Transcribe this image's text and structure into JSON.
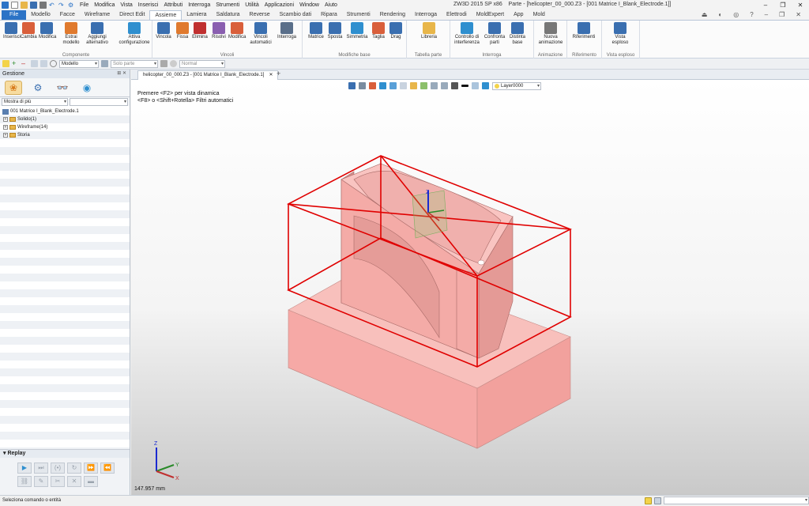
{
  "window": {
    "title": "ZW3D 2015 SP x86",
    "doc_title": "Parte - [helicopter_00_000.Z3 - [001 Matrice I_Blank_Electrode.1]]"
  },
  "menu": [
    "File",
    "Modifica",
    "Vista",
    "Inserisci",
    "Attributi",
    "Interroga",
    "Strumenti",
    "Utilità",
    "Applicazioni",
    "Window",
    "Aiuto"
  ],
  "ribbon_tabs": [
    "File",
    "Modello",
    "Facce",
    "Wireframe",
    "Direct Edit",
    "Assieme",
    "Lamiera",
    "Saldatura",
    "Reverse",
    "Scambio dati",
    "Ripara",
    "Strumenti",
    "Rendering",
    "Interroga",
    "Elettrodi",
    "MoldExpert",
    "App",
    "Mold"
  ],
  "active_tab": "Assieme",
  "groups": {
    "componente": {
      "label": "Componente",
      "buttons": [
        "Inserisci",
        "Cambia",
        "Modifica",
        "Estrai modello",
        "Aggiungi alternativo",
        "Attiva configurazione"
      ]
    },
    "vincoli": {
      "label": "Vincoli",
      "buttons": [
        "Vincola",
        "Fissa",
        "Elimina",
        "Risolvi",
        "Modifica",
        "Vincoli automatici",
        "Interroga"
      ]
    },
    "modifiche": {
      "label": "Modifiche base",
      "buttons": [
        "Matrice",
        "Sposta",
        "Simmetria",
        "Taglia",
        "Drag"
      ]
    },
    "tabella": {
      "label": "Tabella parte",
      "buttons": [
        "Libreria"
      ]
    },
    "interroga": {
      "label": "Interroga",
      "buttons": [
        "Controllo di interferenza",
        "Confronta parti",
        "Distinta base"
      ]
    },
    "animazione": {
      "label": "Animazione",
      "buttons": [
        "Nuova animazione"
      ]
    },
    "riferimento": {
      "label": "Riferimento",
      "buttons": [
        "Riferimenti"
      ]
    },
    "esploso": {
      "label": "Vista esploso",
      "buttons": [
        "Vista esploso"
      ]
    }
  },
  "command_bar": {
    "filter": "Modello",
    "scope": "Solo parte",
    "mode": "Normal"
  },
  "left_panel": {
    "title": "Gestione",
    "filter": "Mostra di più",
    "tree": [
      {
        "label": "001 Matrice I_Blank_Electrode.1"
      },
      {
        "label": "Solido(1)"
      },
      {
        "label": "Wireframe(14)"
      },
      {
        "label": "Storia"
      }
    ],
    "replay": "Replay"
  },
  "doc_tab": "helicopter_00_000.Z3 - [001 Matrice I_Blank_Electrode.1]",
  "viewport": {
    "hint1": "Premere <F2> per vista dinamica",
    "hint2": "<F8> o <Shift+Rotella> Filtri automatici",
    "layer": "Layer0000",
    "distance": "147.957 mm",
    "triad": {
      "x": "X",
      "y": "Y",
      "z": "Z"
    }
  },
  "status": "Seleziona comando o entità",
  "colors": {
    "accent": "#2b73c6",
    "part": "#f4a8a8",
    "bbox": "#e00000"
  }
}
